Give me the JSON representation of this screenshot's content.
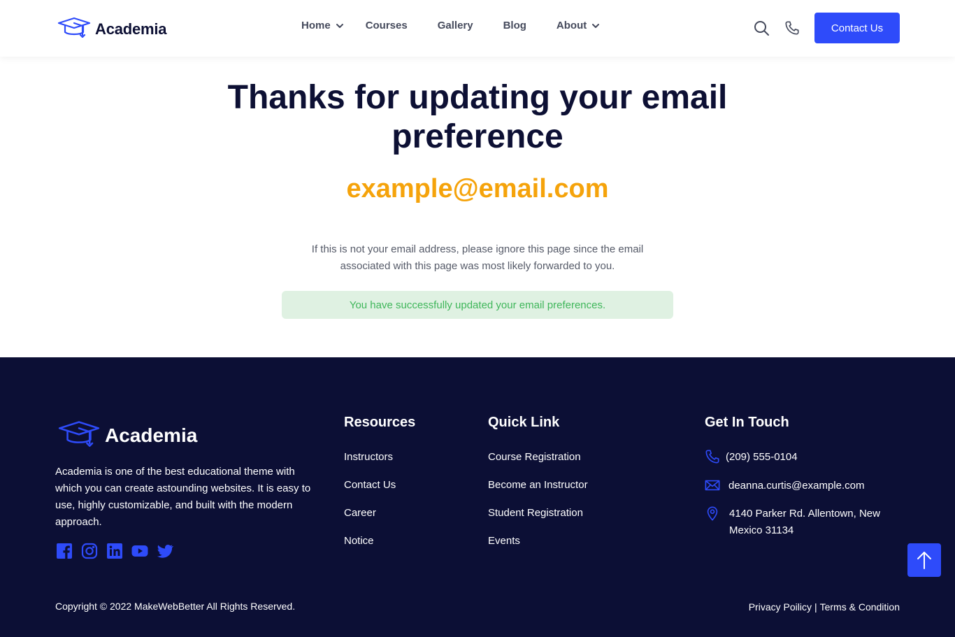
{
  "header": {
    "brand": "Academia",
    "nav": [
      {
        "label": "Home",
        "has_dropdown": true
      },
      {
        "label": "Courses",
        "has_dropdown": false
      },
      {
        "label": "Gallery",
        "has_dropdown": false
      },
      {
        "label": "Blog",
        "has_dropdown": false
      },
      {
        "label": "About",
        "has_dropdown": true
      }
    ],
    "icons": [
      "search-icon",
      "phone-icon"
    ],
    "contact_button": "Contact Us"
  },
  "main": {
    "heading": "Thanks for updating your email preference",
    "email": "example@email.com",
    "note": "If this is not your email address, please ignore this page since the email associated with this page was most likely forwarded to you.",
    "success_message": "You have successfully updated your email preferences."
  },
  "footer": {
    "brand": "Academia",
    "description": "Academia is one of the best educational theme with which you can create astounding websites. It is easy to use, highly customizable, and built with the modern approach.",
    "social": [
      "facebook-icon",
      "instagram-icon",
      "linkedin-icon",
      "youtube-icon",
      "twitter-icon"
    ],
    "resources": {
      "title": "Resources",
      "links": [
        "Instructors",
        "Contact Us",
        "Career",
        "Notice"
      ]
    },
    "quick_link": {
      "title": "Quick Link",
      "links": [
        "Course Registration",
        "Become an Instructor",
        "Student Registration",
        "Events"
      ]
    },
    "get_in_touch": {
      "title": "Get In Touch",
      "phone": "(209) 555-0104",
      "email": "deanna.curtis@example.com",
      "address": "4140 Parker Rd. Allentown, New Mexico 31134"
    },
    "copyright": "Copyright © 2022 MakeWebBetter All Rights Reserved.",
    "privacy": "Privacy Poilicy",
    "separator": "|",
    "terms": "Terms & Condition"
  },
  "colors": {
    "primary": "#2e4bfa",
    "accent": "#f5a30b",
    "dark": "#0c0f35",
    "success_bg": "#dff1e2",
    "success_text": "#3fb65a"
  }
}
